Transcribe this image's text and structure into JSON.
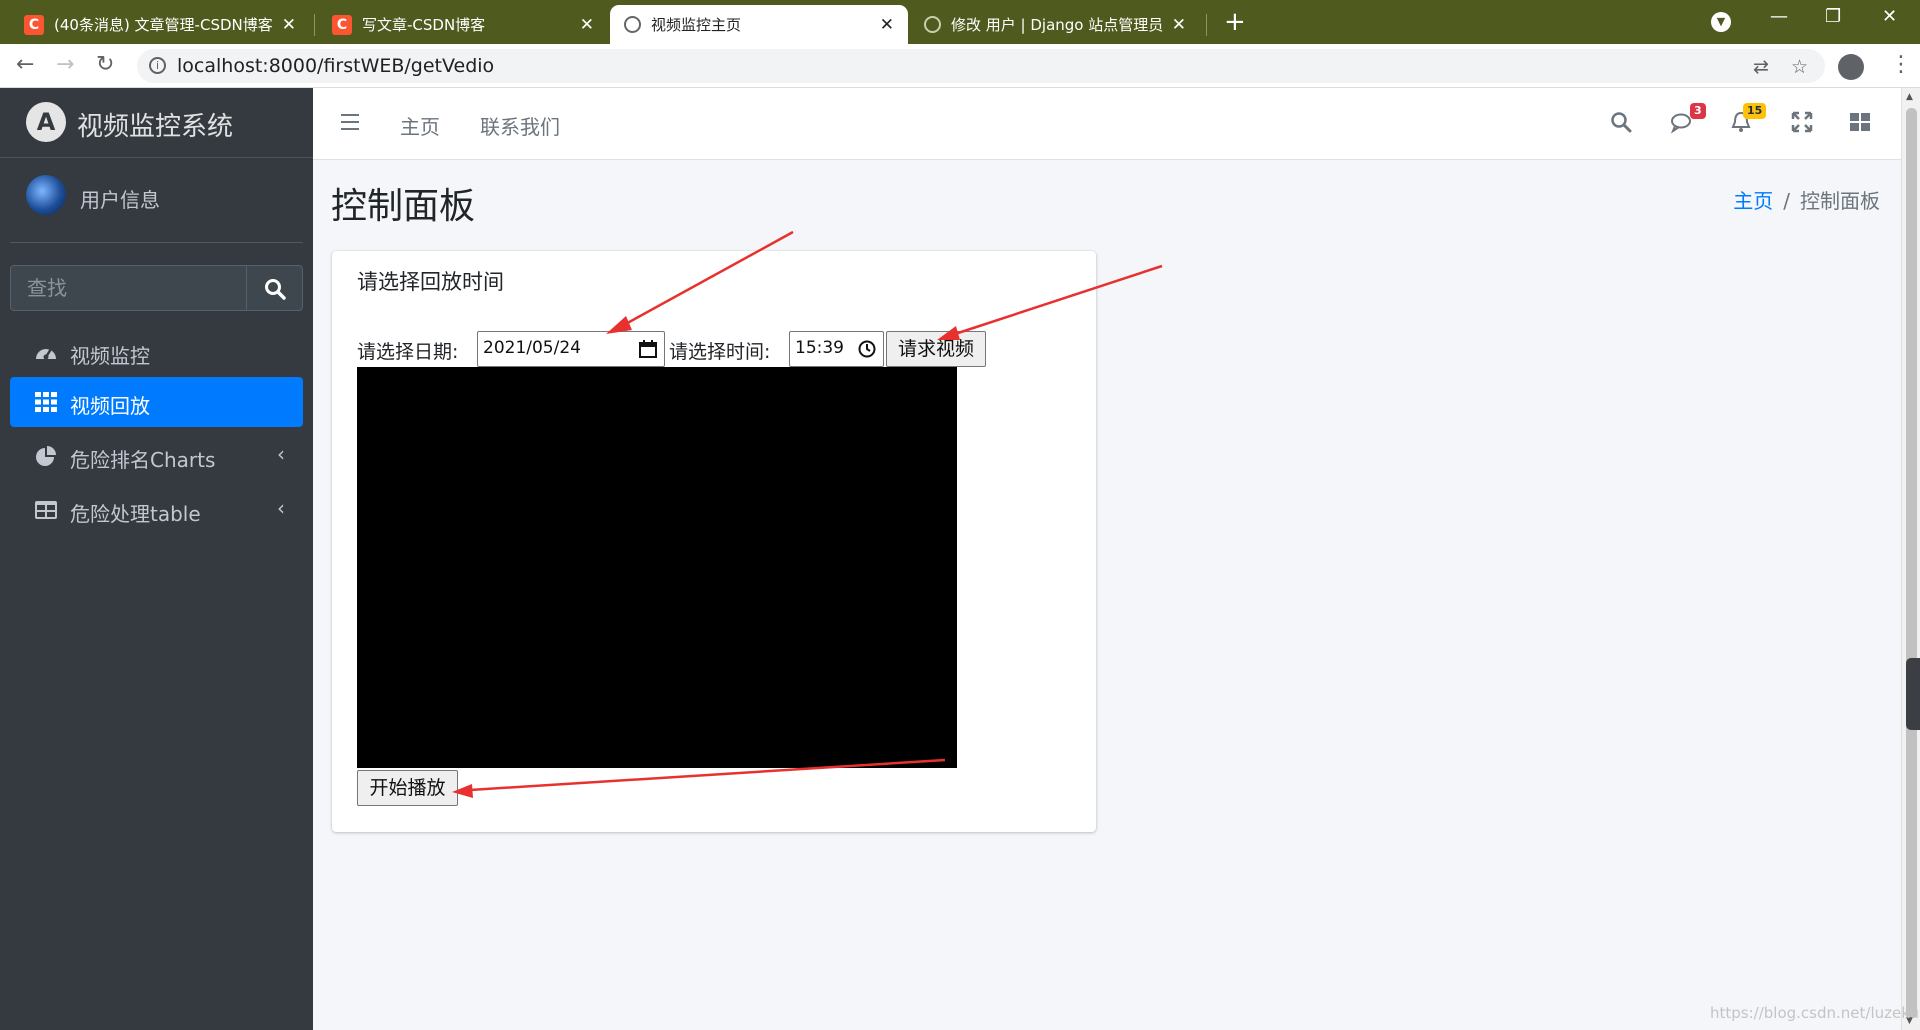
{
  "browser": {
    "tabs": [
      {
        "label": "(40条消息) 文章管理-CSDN博客",
        "favicon": "csdn-icon"
      },
      {
        "label": "写文章-CSDN博客",
        "favicon": "csdn-icon"
      },
      {
        "label": "视频监控主页",
        "favicon": "globe-icon"
      },
      {
        "label": "修改 用户 | Django 站点管理员",
        "favicon": "globe-icon"
      }
    ],
    "new_tab": "+",
    "url": "localhost:8000/firstWEB/getVedio"
  },
  "sidebar": {
    "brand": {
      "logo_letter": "A",
      "title": "视频监控系统"
    },
    "user": {
      "name": "用户信息"
    },
    "search": {
      "placeholder": "查找"
    },
    "items": [
      {
        "label": "视频监控",
        "icon": "dashboard-icon",
        "active": false,
        "has_arrow": false
      },
      {
        "label": "视频回放",
        "icon": "grid-icon",
        "active": true,
        "has_arrow": false
      },
      {
        "label": "危险排名Charts",
        "icon": "pie-chart-icon",
        "active": false,
        "has_arrow": true
      },
      {
        "label": "危险处理table",
        "icon": "table-icon",
        "active": false,
        "has_arrow": true
      }
    ]
  },
  "topnav": {
    "links": [
      "主页",
      "联系我们"
    ],
    "messages_badge": "3",
    "notifications_badge": "15"
  },
  "content": {
    "title": "控制面板",
    "breadcrumb": {
      "home": "主页",
      "separator": "/",
      "current": "控制面板"
    }
  },
  "card": {
    "title": "请选择回放时间",
    "date_label": "请选择日期:",
    "date_value": "2021/05/24",
    "time_label": "请选择时间:",
    "time_value": "15:39",
    "request_button": "请求视频",
    "play_button": "开始播放"
  },
  "watermark": "https://blog.csdn.net/luzeku",
  "colors": {
    "tabbar": "#4f5a1e",
    "sidebar": "#343a40",
    "accent": "#007bff",
    "annotation_arrow": "#e8312f",
    "badge_danger": "#dc3545",
    "badge_warning": "#ffc107"
  }
}
